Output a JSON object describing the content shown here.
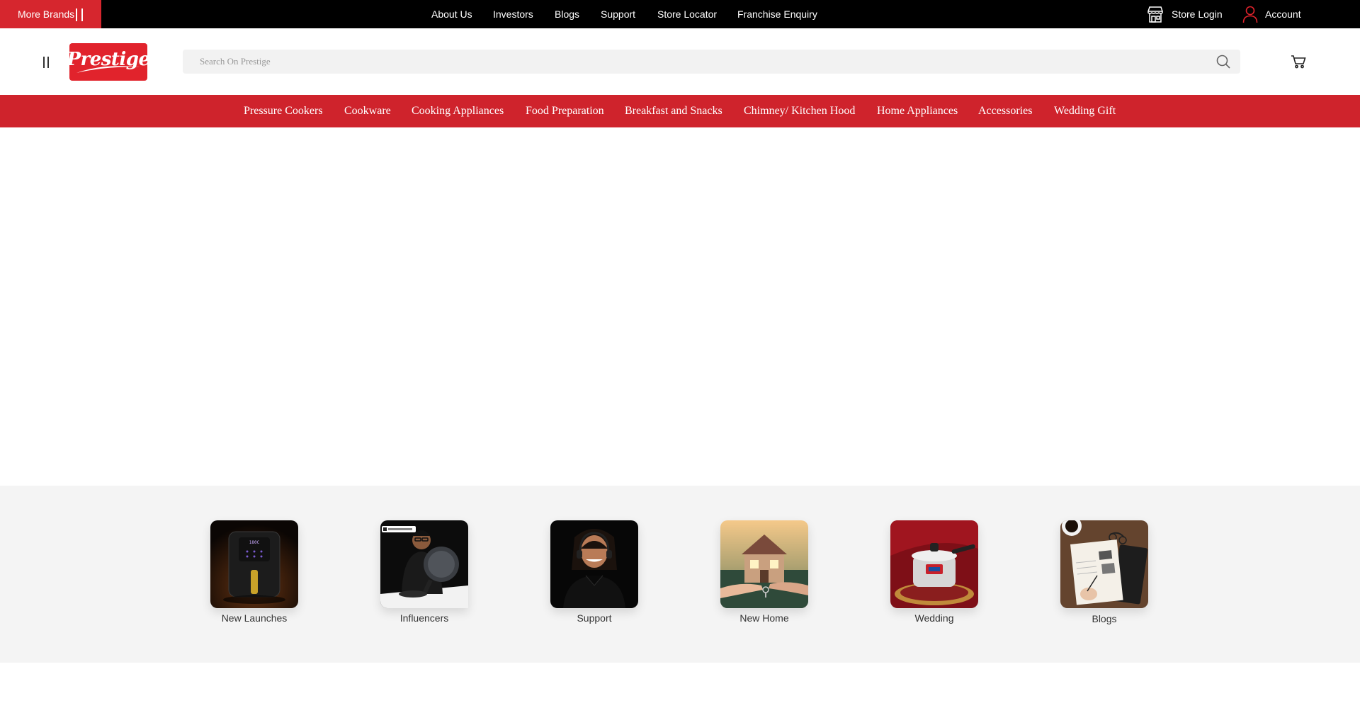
{
  "topbar": {
    "more_brands_label": "More Brands",
    "links": [
      "About Us",
      "Investors",
      "Blogs",
      "Support",
      "Store Locator",
      "Franchise Enquiry"
    ],
    "store_login_label": "Store Login",
    "store_icon": "store-icon",
    "account_label": "Account",
    "account_icon": "user-icon"
  },
  "header": {
    "logo_text": "Prestige",
    "search_placeholder": "Search On Prestige",
    "search_icon": "search-icon",
    "cart_icon": "cart-icon",
    "menu_icon": "menu-icon"
  },
  "category_nav": {
    "items": [
      "Pressure Cookers",
      "Cookware",
      "Cooking Appliances",
      "Food Preparation",
      "Breakfast and Snacks",
      "Chimney/ Kitchen Hood",
      "Home Appliances",
      "Accessories",
      "Wedding Gift"
    ]
  },
  "category_tiles": {
    "items": [
      {
        "label": "New Launches",
        "image": "air-fryer-image"
      },
      {
        "label": "Influencers",
        "image": "influencer-with-pan-image"
      },
      {
        "label": "Support",
        "image": "support-agent-image"
      },
      {
        "label": "New Home",
        "image": "house-keys-image"
      },
      {
        "label": "Wedding",
        "image": "wedding-pressure-cooker-image"
      },
      {
        "label": "Blogs",
        "image": "notebook-desk-image"
      }
    ]
  },
  "colors": {
    "brand_red": "#d6262e",
    "nav_red": "#cf232c",
    "topbar_black": "#000000",
    "strip_gray": "#f4f4f4"
  }
}
